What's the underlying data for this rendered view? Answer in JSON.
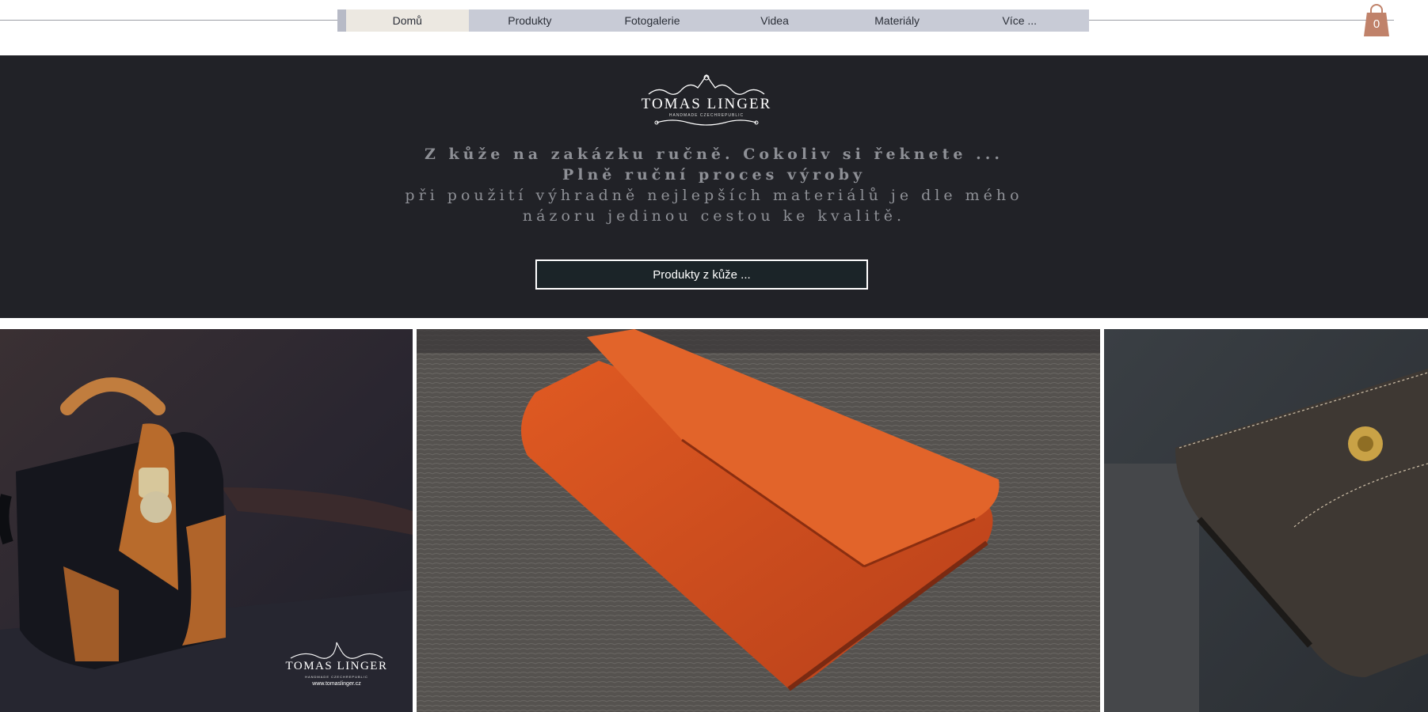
{
  "nav": {
    "items": [
      {
        "label": "Domů",
        "active": true
      },
      {
        "label": "Produkty"
      },
      {
        "label": "Fotogalerie"
      },
      {
        "label": "Videa"
      },
      {
        "label": "Materiály"
      },
      {
        "label": "Více ..."
      }
    ]
  },
  "cart": {
    "count": "0",
    "icon": "shopping-bag-icon",
    "color": "#c0826a"
  },
  "hero": {
    "logo": {
      "name": "TOMAS LINGER",
      "tagline": "HANDMADE CZECHREPUBLIC"
    },
    "lines": [
      "Z kůže na zakázku ručně. Cokoliv si řeknete ...",
      "Plně ruční proces výroby",
      "při použití výhradně nejlepších materiálů  je dle mého",
      "názoru jedinou cestou ke kvalitě."
    ],
    "button_label": "Produkty z kůže ...",
    "background": "#212227"
  },
  "gallery": {
    "photos": [
      {
        "subject": "black and tan leather doctor bag"
      },
      {
        "subject": "orange leather wallet on textured surface"
      },
      {
        "subject": "dark brown leather bag with brass clasp"
      }
    ],
    "watermark": {
      "name": "TOMAS LINGER",
      "tagline": "HANDMADE CZECHREPUBLIC",
      "url": "www.tomaslinger.cz"
    }
  }
}
